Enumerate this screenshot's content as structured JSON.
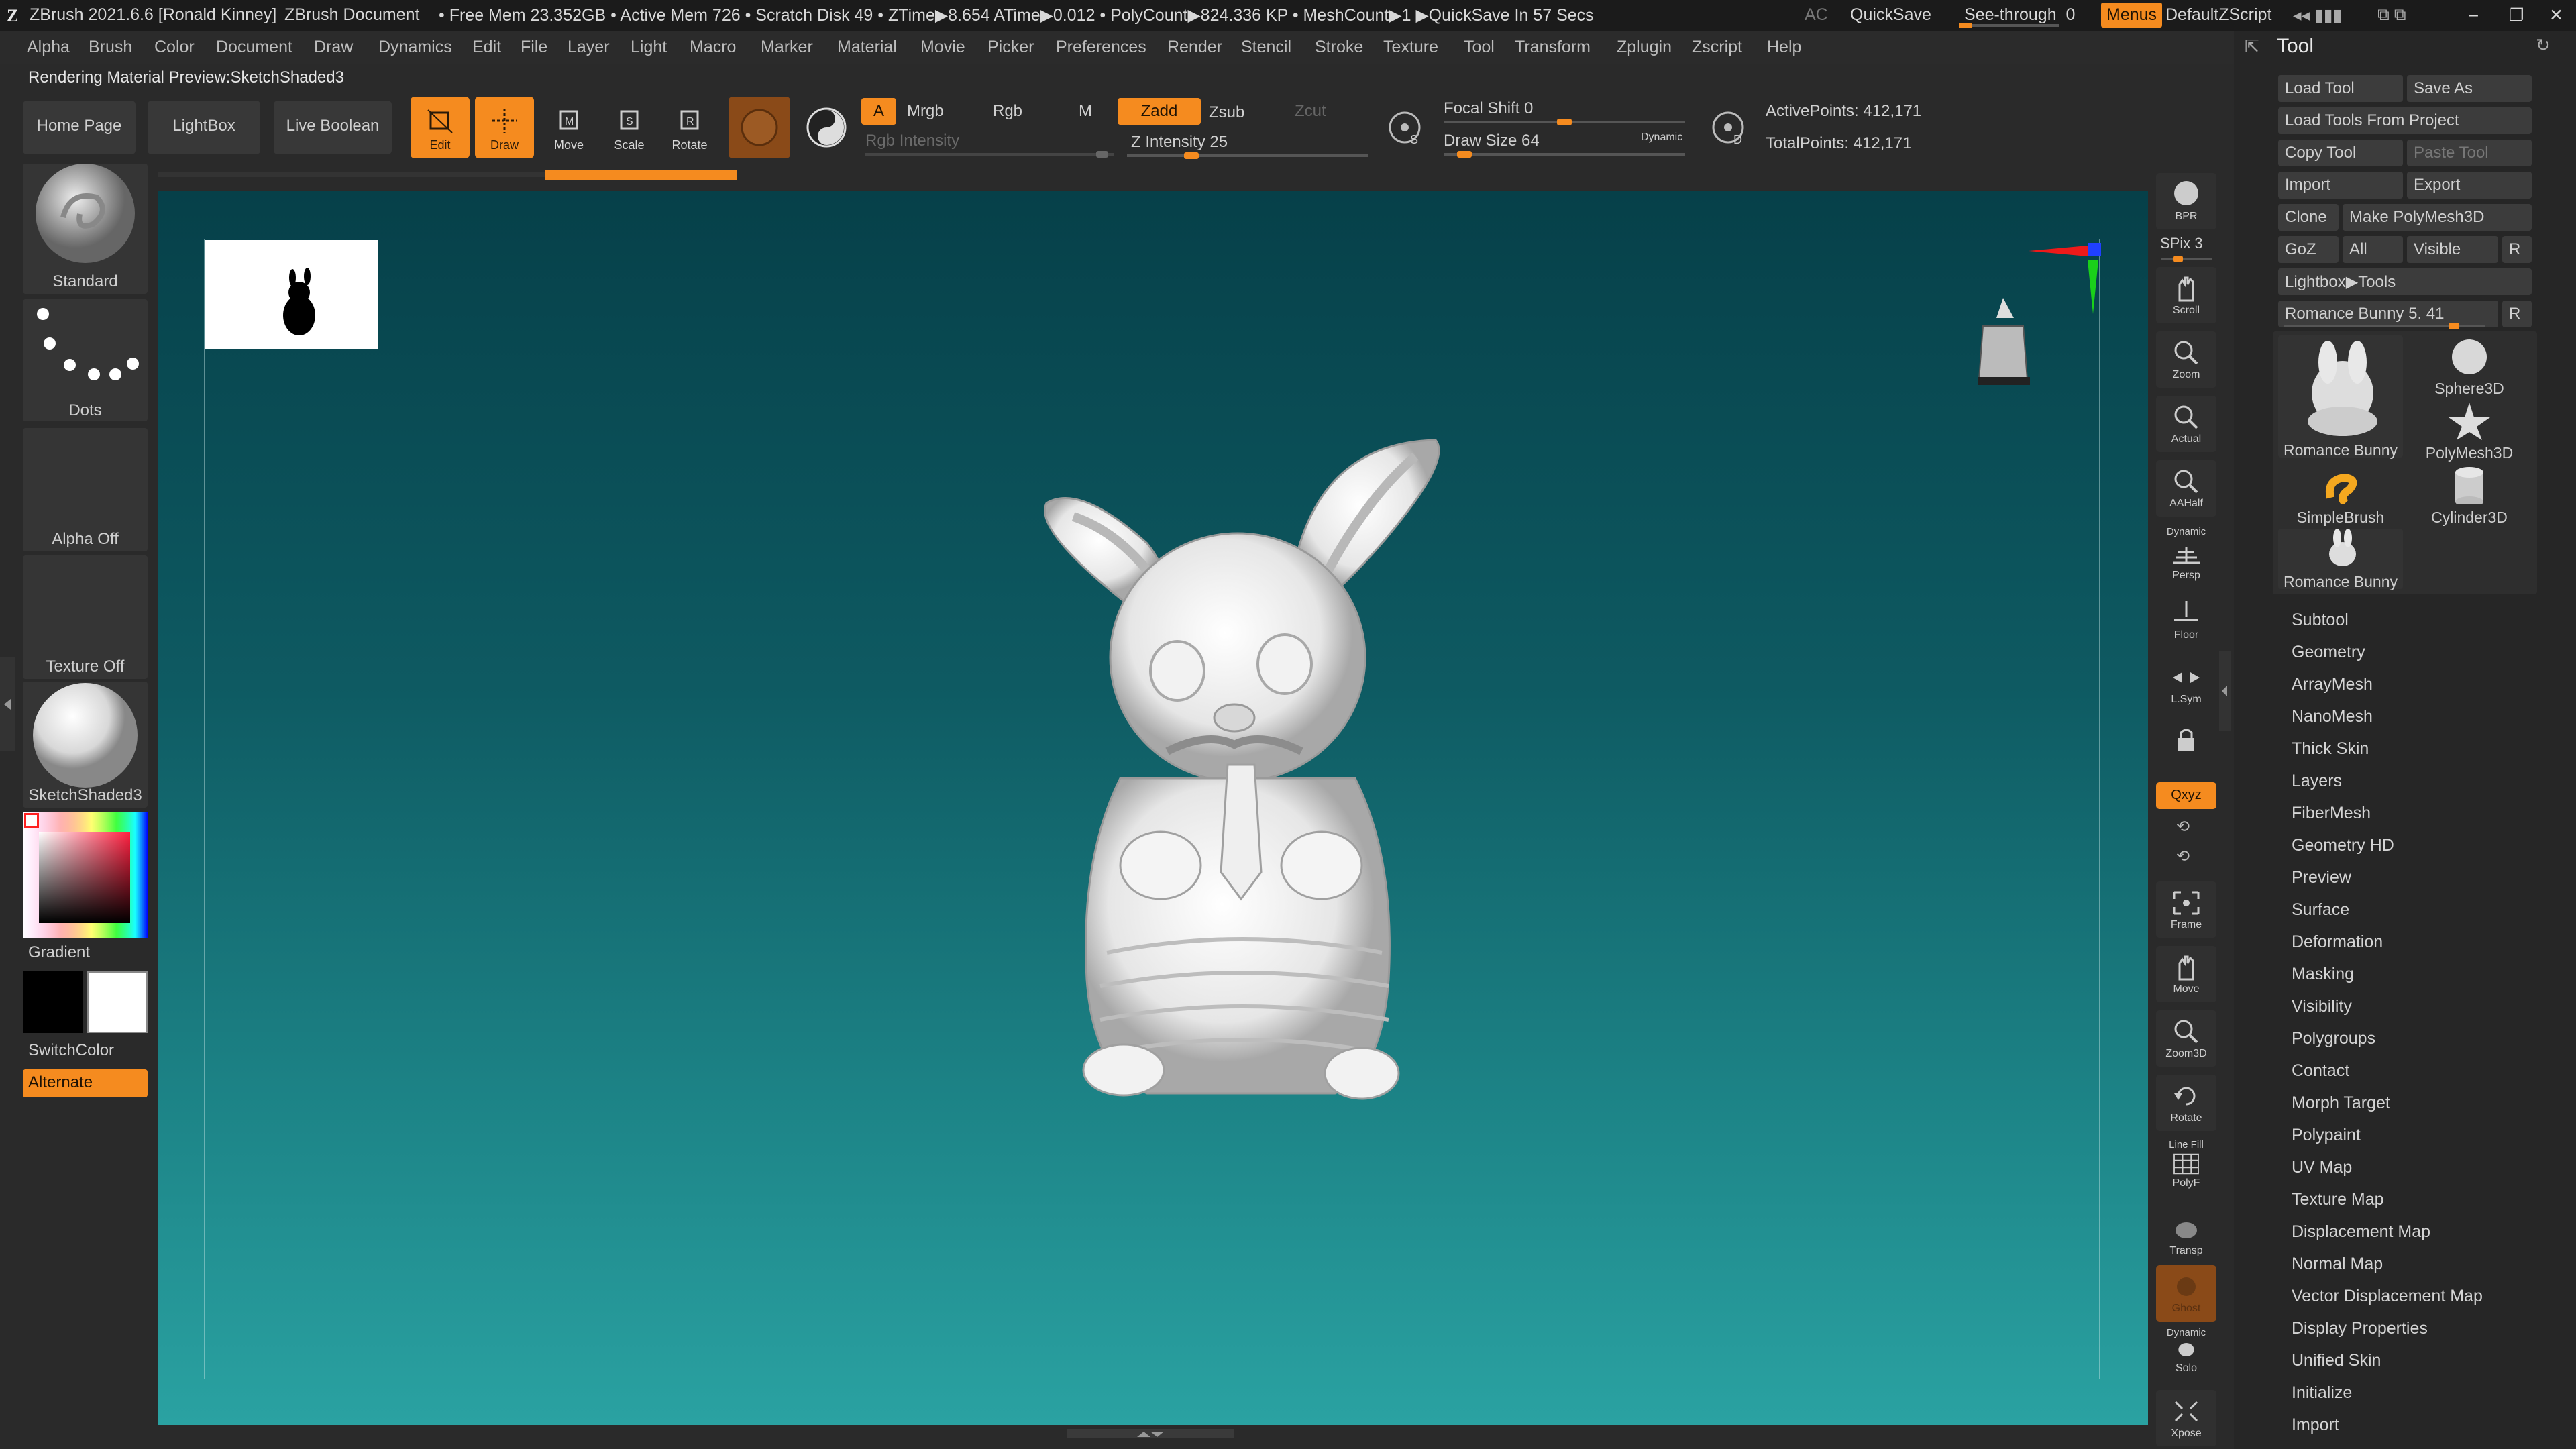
{
  "titlebar": {
    "app": "ZBrush 2021.6.6 [Ronald Kinney]",
    "doc": "ZBrush Document",
    "stats": "• Free Mem 23.352GB • Active Mem 726 • Scratch Disk 49 •  ZTime▶8.654 ATime▶0.012 • PolyCount▶824.336 KP  • MeshCount▶1  ▶QuickSave In 57 Secs",
    "ac": "AC",
    "quicksave": "QuickSave",
    "seethrough": "See-through",
    "seethrough_val": "0",
    "menus": "Menus",
    "script": "DefaultZScript"
  },
  "menubar": [
    "Alpha",
    "Brush",
    "Color",
    "Document",
    "Draw",
    "Dynamics",
    "Edit",
    "File",
    "Layer",
    "Light",
    "Macro",
    "Marker",
    "Material",
    "Movie",
    "Picker",
    "Preferences",
    "Render",
    "Stencil",
    "Stroke",
    "Texture",
    "Tool",
    "Transform",
    "Zplugin",
    "Zscript",
    "Help"
  ],
  "status": "Rendering Material Preview:SketchShaded3",
  "shelf": {
    "home": "Home Page",
    "lightbox": "LightBox",
    "liveboolean": "Live Boolean",
    "edit": "Edit",
    "draw": "Draw",
    "move": "Move",
    "scale": "Scale",
    "rotate": "Rotate",
    "a": "A",
    "mrgb": "Mrgb",
    "rgb": "Rgb",
    "m": "M",
    "zadd": "Zadd",
    "zsub": "Zsub",
    "zcut": "Zcut",
    "rgb_intensity": "Rgb Intensity",
    "z_intensity": "Z Intensity 25",
    "z_intensity_value": 0.25,
    "focal_shift": "Focal Shift 0",
    "focal_shift_value": 0.5,
    "draw_size": "Draw Size 64",
    "draw_size_value": 0.06,
    "dynamic": "Dynamic",
    "active_points": "ActivePoints: 412,171",
    "total_points": "TotalPoints: 412,171",
    "s": "S",
    "d": "D"
  },
  "left": {
    "brush": "Standard",
    "stroke": "Dots",
    "alpha": "Alpha Off",
    "texture": "Texture Off",
    "material": "SketchShaded3",
    "gradient": "Gradient",
    "switchcolor": "SwitchColor",
    "alternate": "Alternate"
  },
  "right_strip": {
    "bpr": "BPR",
    "spix": "SPix 3",
    "scroll": "Scroll",
    "zoom": "Zoom",
    "actual": "Actual",
    "aahalf": "AAHalf",
    "dynamic": "Dynamic",
    "persp": "Persp",
    "floor": "Floor",
    "lsym": "L.Sym",
    "xyz": "Qxyz",
    "frame": "Frame",
    "move": "Move",
    "zoom3d": "Zoom3D",
    "rotate": "Rotate",
    "linefill": "Line Fill",
    "polyf": "PolyF",
    "transp": "Transp",
    "ghost": "Ghost",
    "dynamic2": "Dynamic",
    "solo": "Solo",
    "xpose": "Xpose"
  },
  "tool": {
    "title": "Tool",
    "load_tool": "Load Tool",
    "save_as": "Save As",
    "load_from_project": "Load Tools From Project",
    "copy_tool": "Copy Tool",
    "paste_tool": "Paste Tool",
    "import": "Import",
    "export": "Export",
    "clone": "Clone",
    "make_polymesh": "Make PolyMesh3D",
    "goz": "GoZ",
    "all": "All",
    "visible": "Visible",
    "r": "R",
    "lightbox_tools": "Lightbox▶Tools",
    "current": "Romance Bunny 5. 41",
    "current_r": "R",
    "thumbs": [
      "Romance Bunny",
      "Sphere3D",
      "PolyMesh3D",
      "SimpleBrush",
      "Cylinder3D",
      "Romance Bunny"
    ],
    "subpalettes": [
      "Subtool",
      "Geometry",
      "ArrayMesh",
      "NanoMesh",
      "Thick Skin",
      "Layers",
      "FiberMesh",
      "Geometry HD",
      "Preview",
      "Surface",
      "Deformation",
      "Masking",
      "Visibility",
      "Polygroups",
      "Contact",
      "Morph Target",
      "Polypaint",
      "UV Map",
      "Texture Map",
      "Displacement Map",
      "Normal Map",
      "Vector Displacement Map",
      "Display Properties",
      "Unified Skin",
      "Initialize",
      "Import"
    ]
  },
  "colors": {
    "accent": "#f58b1f",
    "canvas_top": "#064049",
    "canvas_bottom": "#2aa2a2"
  }
}
